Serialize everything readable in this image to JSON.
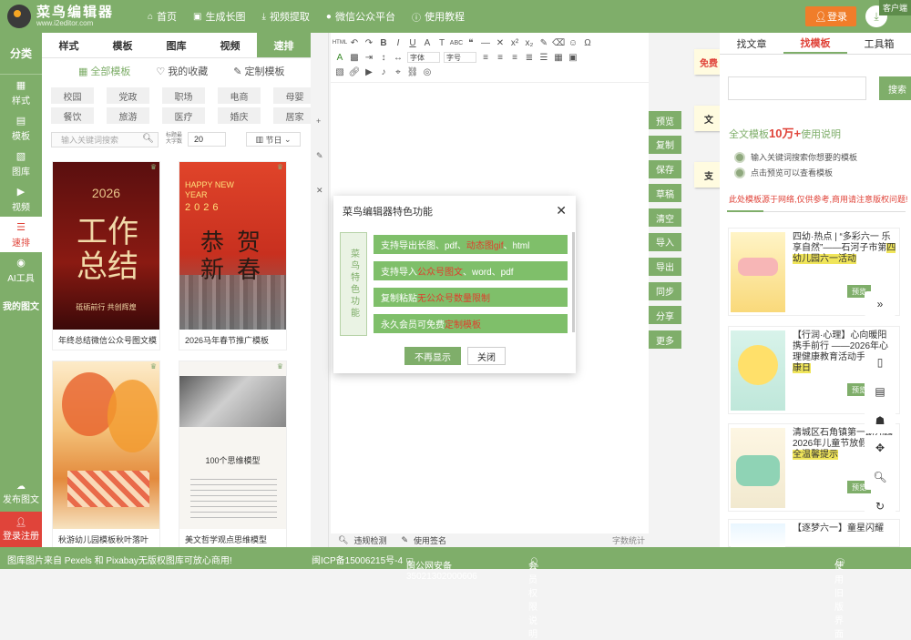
{
  "app": {
    "logo_title": "菜鸟编辑器",
    "logo_sub": "www.i2editor.com",
    "client_tag": "客户端"
  },
  "topnav": [
    {
      "icon": "home-icon",
      "label": "首页"
    },
    {
      "icon": "image-icon",
      "label": "生成长图"
    },
    {
      "icon": "download-icon",
      "label": "视频提取"
    },
    {
      "icon": "wechat-icon",
      "label": "微信公众平台"
    },
    {
      "icon": "info-icon",
      "label": "使用教程"
    }
  ],
  "login": {
    "label": "登录"
  },
  "leftnav": {
    "category": "分类",
    "items": [
      {
        "icon": "style-icon",
        "label": "样式"
      },
      {
        "icon": "template-icon",
        "label": "模板"
      },
      {
        "icon": "gallery-icon",
        "label": "图库"
      },
      {
        "icon": "video-icon",
        "label": "视频"
      },
      {
        "icon": "quick-layout-icon",
        "label": "速排"
      },
      {
        "icon": "ai-icon",
        "label": "AI工具"
      },
      {
        "icon": "my-article-icon",
        "label": "我的图文"
      }
    ],
    "publish": "发布图文",
    "login_register": "登录注册"
  },
  "panel": {
    "tabs": [
      "样式",
      "模板",
      "图库",
      "视频",
      "速排"
    ],
    "subtabs": [
      "全部模板",
      "我的收藏",
      "定制模板"
    ],
    "tags": [
      "校园",
      "党政",
      "职场",
      "电商",
      "母婴",
      "餐饮",
      "旅游",
      "医疗",
      "婚庆",
      "居家"
    ],
    "search_placeholder": "输入关键词搜索",
    "max_label": "标题最大字数",
    "max_value": "20",
    "festival": "节日",
    "cards": [
      {
        "title": "年终总结微信公众号图文模",
        "img_big": "工作总结",
        "img_top": "2026",
        "img_bottom": "砥砺前行 共创辉煌"
      },
      {
        "title": "2026马年春节推广模板",
        "img_top": "HAPPY NEW YEAR",
        "img_year": "2026",
        "img_big": "恭贺新春"
      },
      {
        "title": "秋游幼儿园模板秋叶落叶",
        "img_big": ""
      },
      {
        "title": "美文哲学观点思维模型",
        "img_big": "100个思维模型"
      }
    ]
  },
  "editor": {
    "font_select": "字体",
    "size_select": "字号",
    "side_buttons": [
      "预览",
      "复制",
      "保存",
      "草稿",
      "清空",
      "导入",
      "导出",
      "同步",
      "分享",
      "更多"
    ],
    "stickers": [
      "免费",
      "文",
      "支"
    ],
    "footer": {
      "check": "违规检测",
      "sign": "使用签名",
      "count": "字数统计"
    }
  },
  "right": {
    "tabs": [
      "找文章",
      "找模板",
      "工具箱"
    ],
    "search_btn": "搜索",
    "fulltext_pre": "全文模板",
    "fulltext_num": "10万+",
    "fulltext_post": "使用说明",
    "tips": [
      "输入关键词搜索你想要的模板",
      "点击预览可以查看模板"
    ],
    "warning": "此处模板源于网络,仅供参考,商用请注意版权问题!",
    "cards": [
      {
        "title_a": "四幼·热点 | “多彩六一 乐享自然”——石河子市第",
        "title_hl": "四幼儿园六一活动",
        "preview": "预览"
      },
      {
        "title_a": "【行润·心理】心向暖阳 携手前行 ——2026年心理健康教育活动手",
        "title_hl": "心理健康日",
        "preview": "预览"
      },
      {
        "title_a": "清城区石角镇第一幼儿园2026年儿童节放假通知",
        "title_hl": "安全温馨提示",
        "preview": "预览"
      },
      {
        "title_a": "【逐梦六一】童星闪耀",
        "title_hl": "",
        "preview": ""
      }
    ]
  },
  "modal": {
    "title": "菜鸟编辑器特色功能",
    "side": "菜鸟特色功能",
    "features": [
      {
        "plain": "支持导出长图、pdf、",
        "red": "动态图gif",
        "tail": "、html"
      },
      {
        "plain": "支持导入",
        "red": "公众号图文",
        "tail": "、word、pdf"
      },
      {
        "plain": "复制粘贴",
        "red": "无公众号数量限制",
        "tail": ""
      },
      {
        "plain": "永久会员可免费",
        "red": "定制模板",
        "tail": ""
      }
    ],
    "no_show": "不再显示",
    "close": "关闭"
  },
  "footer": {
    "left": "图库图片来自 Pexels 和 Pixabay无版权图库可放心商用!",
    "icp": "闽ICP备15006215号-4",
    "police": "闽公网安备35021302000606",
    "member": "会员权限说明",
    "old": "使用旧版界面"
  }
}
